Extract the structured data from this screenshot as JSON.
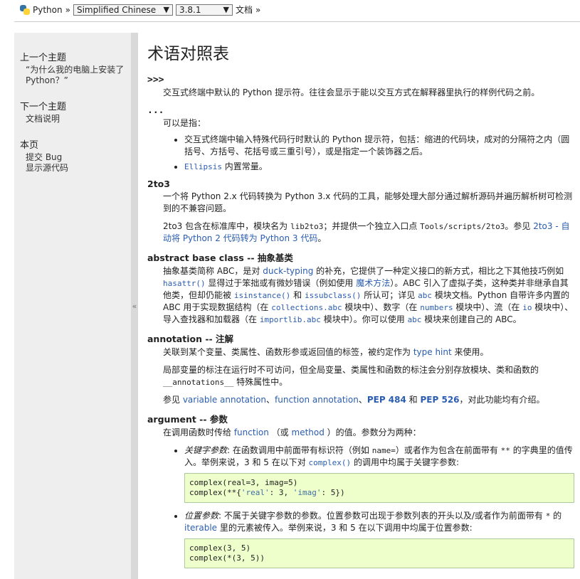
{
  "topbar": {
    "logo_label": "Python",
    "sep1": "»",
    "language": "Simplified Chinese",
    "version": "3.8.1",
    "docs_label": "文档",
    "sep2": "»"
  },
  "sidebar": {
    "prev_title": "上一个主题",
    "prev_link": "“为什么我的电脑上安装了 Python？”",
    "next_title": "下一个主题",
    "next_link": "文档说明",
    "page_title": "本页",
    "report_bug": "提交 Bug",
    "show_source": "显示源代码",
    "collapse": "«"
  },
  "main": {
    "title": "术语对照表",
    "entries": {
      "prompt": {
        "term": ">>>",
        "desc": "交互式终端中默认的 Python 提示符。往往会显示于能以交互方式在解释器里执行的样例代码之前。"
      },
      "ellipsis": {
        "term": "...",
        "lead": "可以是指：",
        "li1": "交互式终端中输入特殊代码行时默认的 Python 提示符，包括：缩进的代码块，成对的分隔符之内（圆括号、方括号、花括号或三重引号），或是指定一个装饰器之后。",
        "li2_code": "Ellipsis",
        "li2_text": " 内置常量。"
      },
      "to3": {
        "term": "2to3",
        "p1": "一个将 Python 2.x 代码转换为 Python 3.x 代码的工具，能够处理大部分通过解析源码并遍历解析树可检测到的不兼容问题。",
        "p2a": "2to3 包含在标准库中，模块名为 ",
        "p2_code1": "lib2to3",
        "p2b": "；并提供一个独立入口点 ",
        "p2_code2": "Tools/scripts/2to3",
        "p2c": "。参见 ",
        "p2_link": "2to3 - 自动将 Python 2 代码转为 Python 3 代码",
        "p2d": "。"
      },
      "abc": {
        "term": "abstract base class -- 抽象基类",
        "t1": "抽象基类简称 ABC，是对 ",
        "l1": "duck-typing",
        "t2": " 的补充，它提供了一种定义接口的新方式，相比之下其他技巧例如 ",
        "c1": "hasattr()",
        "t3": " 显得过于笨拙或有微妙错误（例如使用 ",
        "l2": "魔术方法",
        "t4": "）。ABC 引入了虚拟子类，这种类并非继承自其他类，但却仍能被 ",
        "c2": "isinstance()",
        "t5": " 和 ",
        "c3": "issubclass()",
        "t6": " 所认可；详见 ",
        "c4": "abc",
        "t7": " 模块文档。Python 自带许多内置的 ABC 用于实现数据结构（在 ",
        "c5": "collections.abc",
        "t8": " 模块中）、数字（在 ",
        "c6": "numbers",
        "t9": " 模块中）、流（在 ",
        "c7": "io",
        "t10": " 模块中）、导入查找器和加载器（在 ",
        "c8": "importlib.abc",
        "t11": " 模块中）。你可以使用 ",
        "c9": "abc",
        "t12": " 模块来创建自己的 ABC。"
      },
      "annotation": {
        "term": "annotation -- 注解",
        "p1a": "关联到某个变量、类属性、函数形参或返回值的标签，被约定作为 ",
        "p1_link": "type hint",
        "p1b": " 来使用。",
        "p2a": "局部变量的标注在运行时不可访问，但全局变量、类属性和函数的标注会分别存放模块、类和函数的 ",
        "p2_code": "__annotations__",
        "p2b": " 特殊属性中。",
        "p3a": "参见 ",
        "p3_l1": "variable annotation",
        "p3_s1": "、",
        "p3_l2": "function annotation",
        "p3_s2": "、",
        "p3_l3": "PEP 484",
        "p3_s3": " 和 ",
        "p3_l4": "PEP 526",
        "p3_b": "，对此功能均有介绍。"
      },
      "argument": {
        "term": "argument -- 参数",
        "p1a": "在调用函数时传给 ",
        "p1_l1": "function",
        "p1b": " （或 ",
        "p1_l2": "method",
        "p1c": " ）的值。参数分为两种：",
        "kw_em": "关键字参数",
        "kw_a": ": 在函数调用中前面带有标识符（例如 ",
        "kw_c1": "name=",
        "kw_b": "）或者作为包含在前面带有 ",
        "kw_c2": "**",
        "kw_c": " 的字典里的值传入。举例来说，3 和 5 在以下对 ",
        "kw_c3": "complex()",
        "kw_d": " 的调用中均属于关键字参数:",
        "code1_line1": "complex(real=3, imag=5)",
        "code1_l2a": "complex(**{",
        "code1_l2s1": "'real'",
        "code1_l2b": ": 3, ",
        "code1_l2s2": "'imag'",
        "code1_l2c": ": 5})",
        "pos_em": "位置参数",
        "pos_a": ": 不属于关键字参数的参数。位置参数可出现于参数列表的开头以及/或者作为前面带有 ",
        "pos_c1": "*",
        "pos_b": " 的 ",
        "pos_l1": "iterable",
        "pos_c": " 里的元素被传入。举例来说，3 和 5 在以下调用中均属于位置参数:",
        "code2_line1": "complex(3, 5)",
        "code2_line2": "complex(*(3, 5))"
      }
    }
  }
}
